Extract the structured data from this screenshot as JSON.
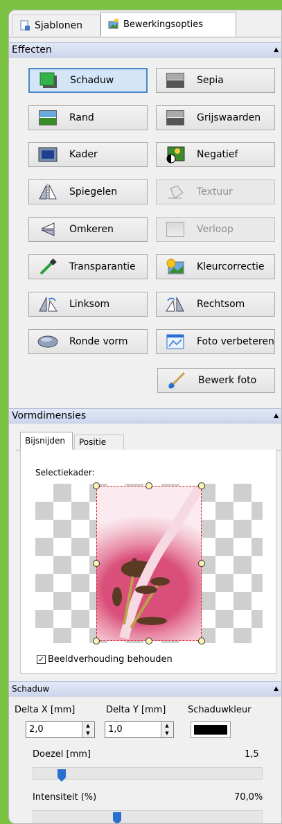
{
  "tabs": [
    {
      "label": "Sjablonen"
    },
    {
      "label": "Bewerkingsopties"
    }
  ],
  "effects": {
    "title": "Effecten",
    "buttons_left": [
      {
        "label": "Schaduw",
        "icon": "shadow-square-icon"
      },
      {
        "label": "Rand",
        "icon": "border-picture-icon"
      },
      {
        "label": "Kader",
        "icon": "frame-icon"
      },
      {
        "label": "Spiegelen",
        "icon": "mirror-icon"
      },
      {
        "label": "Omkeren",
        "icon": "flip-icon"
      },
      {
        "label": "Transparantie",
        "icon": "eyedropper-icon"
      },
      {
        "label": "Linksom",
        "icon": "rotate-left-icon"
      },
      {
        "label": "Ronde vorm",
        "icon": "ellipse-icon"
      }
    ],
    "buttons_right": [
      {
        "label": "Sepia",
        "icon": "sepia-picture-icon"
      },
      {
        "label": "Grijswaarden",
        "icon": "grayscale-picture-icon"
      },
      {
        "label": "Negatief",
        "icon": "negative-picture-icon"
      },
      {
        "label": "Textuur",
        "icon": "texture-icon",
        "disabled": true
      },
      {
        "label": "Verloop",
        "icon": "gradient-icon",
        "disabled": true
      },
      {
        "label": "Kleurcorrectie",
        "icon": "color-correction-icon"
      },
      {
        "label": "Rechtsom",
        "icon": "rotate-right-icon"
      },
      {
        "label": "Foto verbeteren",
        "icon": "enhance-photo-icon"
      }
    ],
    "edit_photo": "Bewerk foto"
  },
  "shape": {
    "title": "Vormdimensies",
    "tabs": [
      "Bijsnijden",
      "Positie"
    ],
    "selection_label": "Selectiekader:",
    "keep_ratio_label": "Beeldverhouding behouden",
    "keep_ratio_checked": true
  },
  "shadow": {
    "title": "Schaduw",
    "delta_x_label": "Delta X [mm]",
    "delta_x_value": "2,0",
    "delta_y_label": "Delta Y [mm]",
    "delta_y_value": "1,0",
    "color_label": "Schaduwkleur",
    "color": "#000000",
    "blur_label": "Doezel [mm]",
    "blur_value": "1,5",
    "blur_slider_fraction": 0.11,
    "intensity_label": "Intensiteit (%)",
    "intensity_value": "70,0%",
    "intensity_slider_fraction": 0.36
  }
}
